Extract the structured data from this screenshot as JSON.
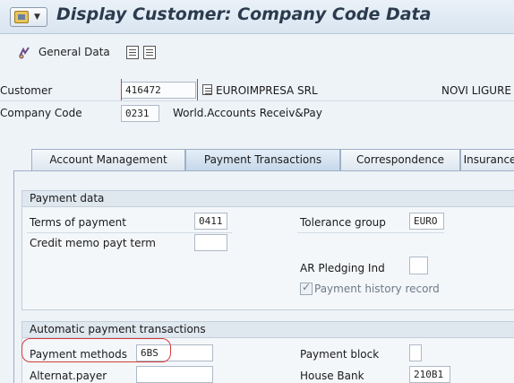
{
  "window": {
    "title": "Display Customer: Company Code Data"
  },
  "toolbar": {
    "general_data_label": "General Data"
  },
  "header": {
    "customer_label": "Customer",
    "customer_value": "416472",
    "customer_name": "EUROIMPRESA SRL",
    "customer_city": "NOVI LIGURE",
    "company_code_label": "Company Code",
    "company_code_value": "0231",
    "company_code_name": "World.Accounts Receiv&Pay"
  },
  "tabs": [
    {
      "label": "Account Management"
    },
    {
      "label": "Payment Transactions"
    },
    {
      "label": "Correspondence"
    },
    {
      "label": "Insurance"
    }
  ],
  "payment_data": {
    "title": "Payment data",
    "terms_of_payment_label": "Terms of payment",
    "terms_of_payment_value": "0411",
    "tolerance_group_label": "Tolerance group",
    "tolerance_group_value": "EURO",
    "credit_memo_label": "Credit memo payt term",
    "credit_memo_value": "",
    "ar_pledging_label": "AR Pledging Ind",
    "ar_pledging_value": "",
    "payment_history_label": "Payment history record",
    "payment_history_checked": true
  },
  "auto_payment": {
    "title": "Automatic payment transactions",
    "payment_methods_label": "Payment methods",
    "payment_methods_value": "6BS",
    "payment_block_label": "Payment block",
    "payment_block_value": "",
    "alternat_payer_label": "Alternat.payer",
    "alternat_payer_value": "",
    "house_bank_label": "House Bank",
    "house_bank_value": "210B1"
  }
}
